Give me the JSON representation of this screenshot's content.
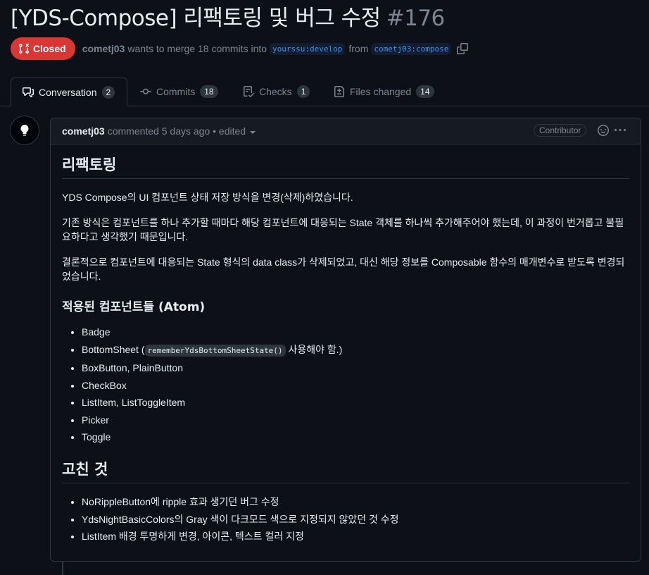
{
  "pr": {
    "title": "[YDS-Compose] 리팩토링 및 버그 수정",
    "number": "#176",
    "state": "Closed",
    "author": "cometj03",
    "merge_text": "wants to merge 18 commits into",
    "base_branch": "yourssu:develop",
    "from_text": "from",
    "head_branch": "cometj03:compose"
  },
  "tabs": [
    {
      "label": "Conversation",
      "count": "2",
      "icon": "comment-discussion-icon"
    },
    {
      "label": "Commits",
      "count": "18",
      "icon": "git-commit-icon"
    },
    {
      "label": "Checks",
      "count": "1",
      "icon": "checklist-icon"
    },
    {
      "label": "Files changed",
      "count": "14",
      "icon": "file-diff-icon"
    }
  ],
  "comment": {
    "author": "cometj03",
    "action": "commented 5 days ago • edited",
    "role": "Contributor",
    "h_refactor": "리팩토링",
    "p1": "YDS Compose의 UI 컴포넌트 상태 저장 방식을 변경(삭제)하였습니다.",
    "p2": "기존 방식은 컴포넌트를 하나 추가할 때마다 해당 컴포넌트에 대응되는 State 객체를 하나씩 추가해주어야 했는데, 이 과정이 번거롭고 불필요하다고 생각했기 때문입니다.",
    "p3": "결론적으로 컴포넌트에 대응되는 State 형식의 data class가 삭제되었고, 대신 해당 정보를 Composable 함수의 매개변수로 받도록 변경되었습니다.",
    "h_applied": "적용된 컴포넌트들 (Atom)",
    "applied": {
      "i0": "Badge",
      "i1_pre": "BottomSheet (",
      "i1_code": "rememberYdsBottomSheetState()",
      "i1_post": " 사용해야 함.)",
      "i2": "BoxButton, PlainButton",
      "i3": "CheckBox",
      "i4": "ListItem, ListToggleItem",
      "i5": "Picker",
      "i6": "Toggle"
    },
    "h_fixed": "고친 것",
    "fixed": [
      "NoRippleButton에 ripple 효과 생기던 버그 수정",
      "YdsNightBasicColors의 Gray 색이 다크모드 색으로 지정되지 않았던 것 수정",
      "ListItem 배경 투명하게 변경, 아이콘, 텍스트 컬러 지정"
    ]
  },
  "colors": {
    "closed": "#da3633",
    "link": "#4493f8",
    "bg": "#0d1117"
  }
}
